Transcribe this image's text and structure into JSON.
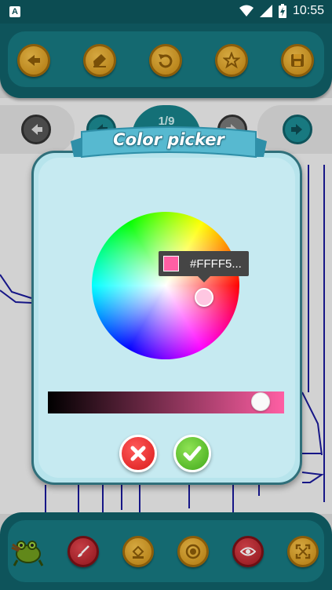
{
  "status_bar": {
    "time": "10:55",
    "icons": [
      "app-notification-icon",
      "wifi-icon",
      "signal-icon",
      "battery-charging-icon"
    ]
  },
  "top_toolbar": {
    "buttons": [
      {
        "icon": "back-arrow-icon"
      },
      {
        "icon": "eraser-icon"
      },
      {
        "icon": "undo-icon"
      },
      {
        "icon": "star-icon"
      },
      {
        "icon": "save-icon"
      }
    ]
  },
  "page_nav": {
    "indicator": "1/9",
    "prev_icon": "arrow-left-icon",
    "next_icon": "arrow-right-icon"
  },
  "dialog": {
    "title": "Color picker",
    "selected_hex": "#FFFF5...",
    "selected_color": "#ff5fa4",
    "brightness_level": 0.9,
    "cancel_icon": "close-icon",
    "ok_icon": "check-icon"
  },
  "bottom_toolbar": {
    "buttons": [
      {
        "icon": "frog-logo-icon"
      },
      {
        "icon": "brush-icon"
      },
      {
        "icon": "fill-bucket-icon"
      },
      {
        "icon": "stamp-icon"
      },
      {
        "icon": "eye-icon"
      },
      {
        "icon": "fullscreen-icon"
      }
    ]
  },
  "colors": {
    "toolbar": "#106068",
    "gold": "#e8a82a",
    "red": "#c02a32",
    "dialog_bg": "#c6eaf1"
  }
}
